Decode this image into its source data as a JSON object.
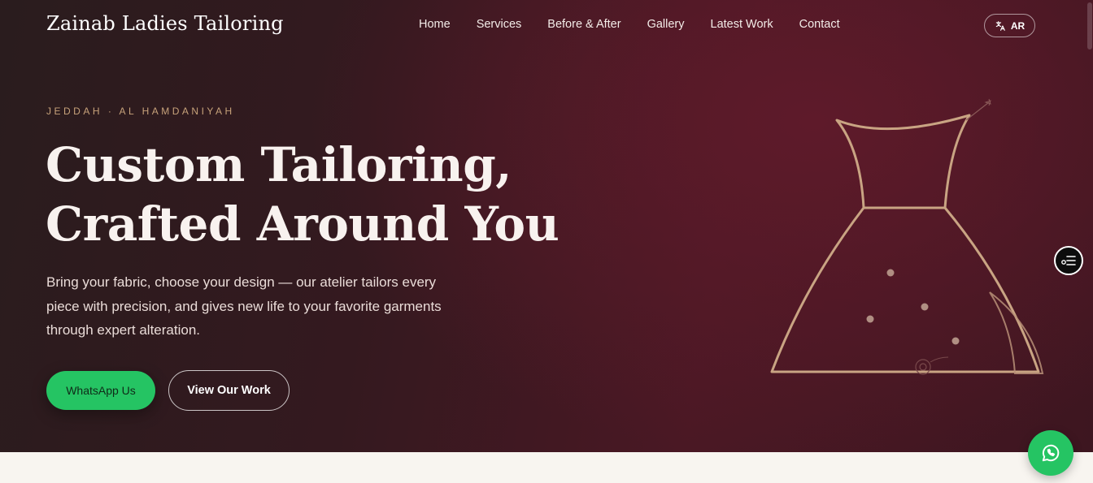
{
  "brand": {
    "name": "Zainab Ladies Tailoring"
  },
  "nav": {
    "items": [
      {
        "label": "Home"
      },
      {
        "label": "Services"
      },
      {
        "label": "Before & After"
      },
      {
        "label": "Gallery"
      },
      {
        "label": "Latest Work"
      },
      {
        "label": "Contact"
      }
    ],
    "lang_toggle": {
      "label": "AR",
      "icon": "translate-icon"
    }
  },
  "hero": {
    "eyebrow": "JEDDAH · AL HAMDANIYAH",
    "headline_line1": "Custom Tailoring,",
    "headline_line2": "Crafted Around You",
    "subtext": "Bring your fabric, choose your design — our atelier tailors every piece with precision, and gives new life to your favorite garments through expert alteration.",
    "cta_primary": "WhatsApp Us",
    "cta_secondary": "View Our Work"
  },
  "floating": {
    "side_toggle_icon": "panel-list-icon",
    "whatsapp_fab_icon": "whatsapp-icon"
  },
  "colors": {
    "accent_green": "#25c463",
    "gold": "#c7a27a",
    "hero_dark": "#2a1c1e",
    "hero_wine": "#5e1a2a",
    "cream": "#f8f5f0"
  }
}
